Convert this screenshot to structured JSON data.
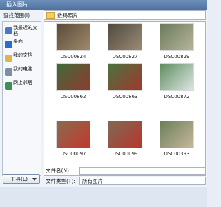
{
  "window": {
    "title": "插入图片"
  },
  "lookin": {
    "label": "查找范围(I)",
    "value": "数码照片"
  },
  "places": [
    {
      "label": "我最近的文档",
      "icon": "recent-documents-icon",
      "color": "#4a78c4"
    },
    {
      "label": "桌面",
      "icon": "desktop-icon",
      "color": "#2e6cc7"
    },
    {
      "label": "我的文档",
      "icon": "my-documents-icon",
      "color": "#e2b34a"
    },
    {
      "label": "我的电脑",
      "icon": "my-computer-icon",
      "color": "#7a8fa6"
    },
    {
      "label": "网上邻居",
      "icon": "network-places-icon",
      "color": "#3f8f5b"
    }
  ],
  "thumbnails": [
    {
      "name": "DSC00824",
      "colors": [
        "#5a4a3a",
        "#a08a6a"
      ]
    },
    {
      "name": "DSC00827",
      "colors": [
        "#4f4a40",
        "#9c8b74"
      ]
    },
    {
      "name": "DSC00829",
      "colors": [
        "#6c7a5c",
        "#b7b59a"
      ]
    },
    {
      "name": "DSC00862",
      "colors": [
        "#3f6a3a",
        "#8f3b2f"
      ]
    },
    {
      "name": "DSC00863",
      "colors": [
        "#4a7240",
        "#a0392c"
      ]
    },
    {
      "name": "DSC00872",
      "colors": [
        "#5f8f5f",
        "#dfe6e6"
      ]
    },
    {
      "name": "DSC00097",
      "colors": [
        "#8a6a52",
        "#c23a2a"
      ]
    },
    {
      "name": "DSC00099",
      "colors": [
        "#7d6a55",
        "#b8362c"
      ]
    },
    {
      "name": "DSC00393",
      "colors": [
        "#6b7f5a",
        "#c7b79a"
      ]
    }
  ],
  "filename": {
    "label": "文件名(N):",
    "value": ""
  },
  "filetype": {
    "label": "文件类型(T):",
    "value": "所有图片"
  },
  "tools": {
    "label": "工具(L)"
  }
}
